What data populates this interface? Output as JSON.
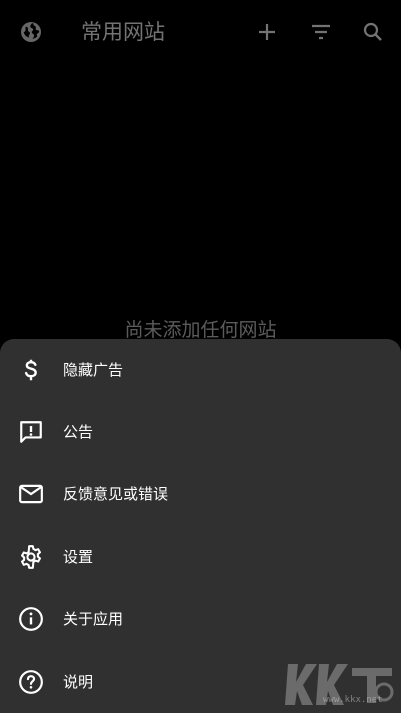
{
  "toolbar": {
    "title": "常用网站",
    "icons": {
      "globe": "globe-icon",
      "add": "add-icon",
      "filter": "filter-icon",
      "search": "search-icon"
    }
  },
  "main": {
    "empty_text": "尚未添加任何网站"
  },
  "menu": {
    "items": [
      {
        "label": "隐藏广告",
        "icon": "dollar-icon"
      },
      {
        "label": "公告",
        "icon": "announcement-icon"
      },
      {
        "label": "反馈意见或错误",
        "icon": "mail-icon"
      },
      {
        "label": "设置",
        "icon": "gear-icon"
      },
      {
        "label": "关于应用",
        "icon": "info-icon"
      },
      {
        "label": "说明",
        "icon": "help-icon"
      }
    ]
  },
  "watermark": {
    "url": "www.kkx.net"
  },
  "colors": {
    "background": "#000000",
    "sheet": "#303030",
    "title": "#9a9a9a",
    "empty_text": "#7a7a7a",
    "icon": "#ffffff"
  }
}
